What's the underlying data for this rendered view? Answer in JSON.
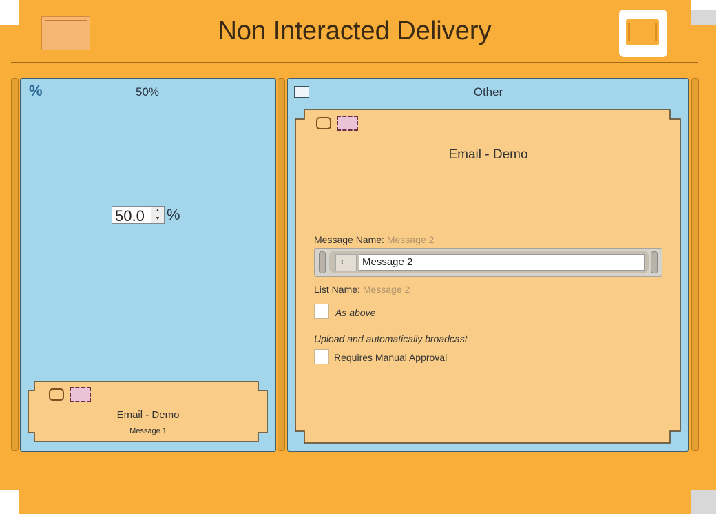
{
  "window": {
    "title": "Non Interacted Delivery"
  },
  "left_panel": {
    "header": "50%",
    "spinner_value": "50.0",
    "unit": "%",
    "spin_up": "▲",
    "spin_down": "▼",
    "card": {
      "title": "Email - Demo",
      "subtitle": "Message 1"
    }
  },
  "right_panel": {
    "header": "Other",
    "card": {
      "title": "Email - Demo",
      "message_name_label": "Message Name:",
      "message_name_value": "Message 2",
      "message_input_value": "Message 2",
      "field_button_glyph": "⟵",
      "list_name_label": "List Name:",
      "list_name_value": "Message 2",
      "as_above_label": "As above",
      "upload_note": "Upload and automatically broadcast",
      "requires_approval_label": "Requires Manual Approval"
    }
  },
  "colors": {
    "frame": "#f9ae3a",
    "panel": "#a4d6eb",
    "card": "#f9cd88"
  }
}
